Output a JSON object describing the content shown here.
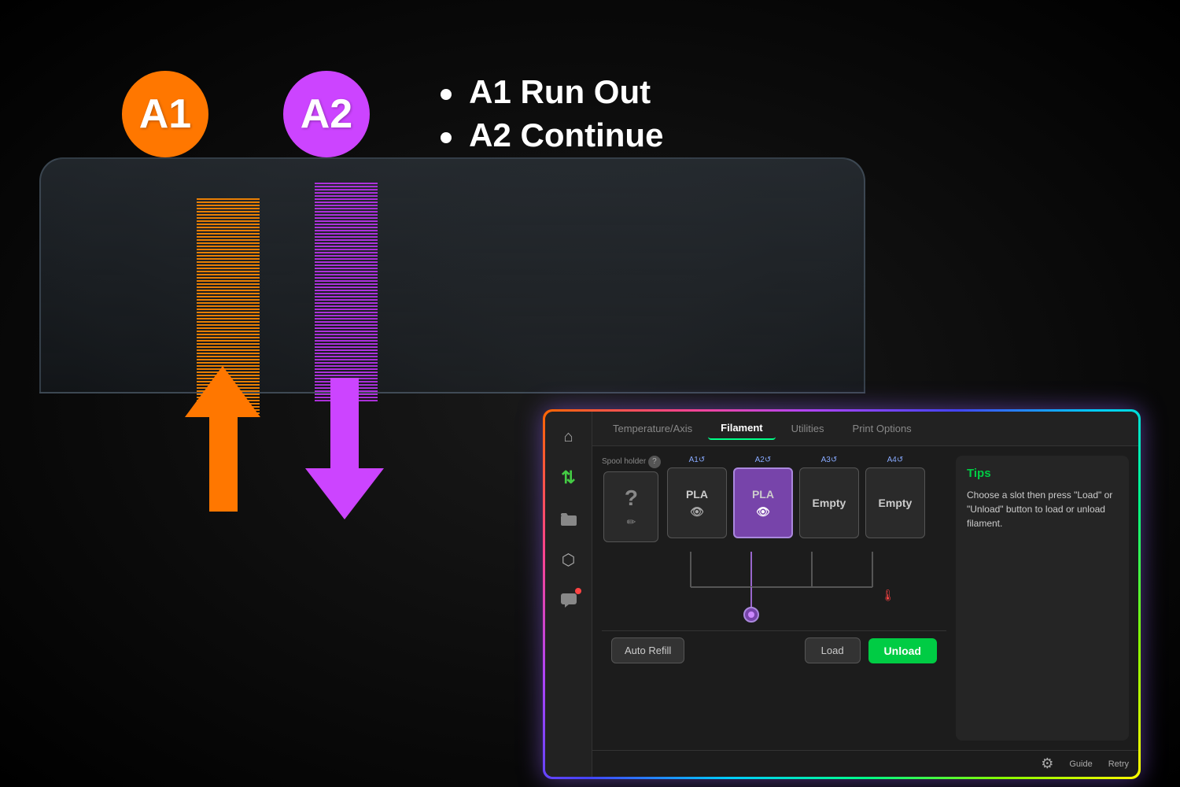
{
  "background": {
    "color": "#000000"
  },
  "badges": {
    "a1": {
      "label": "A1",
      "color": "#ff7700"
    },
    "a2": {
      "label": "A2",
      "color": "#cc44ff"
    }
  },
  "status": {
    "item1": "A1 Run Out",
    "item2": "A2 Continue"
  },
  "panel": {
    "tabs": [
      {
        "id": "temperature",
        "label": "Temperature/Axis",
        "active": false
      },
      {
        "id": "filament",
        "label": "Filament",
        "active": true
      },
      {
        "id": "utilities",
        "label": "Utilities",
        "active": false
      },
      {
        "id": "print-options",
        "label": "Print Options",
        "active": false
      }
    ],
    "sidebar": {
      "icons": [
        {
          "id": "home",
          "symbol": "⌂",
          "active": false
        },
        {
          "id": "settings",
          "symbol": "⇅",
          "active": false
        },
        {
          "id": "files",
          "symbol": "▭",
          "active": false
        },
        {
          "id": "config",
          "symbol": "⬡",
          "active": false
        },
        {
          "id": "messages",
          "symbol": "✉",
          "active": false,
          "has_dot": true
        }
      ]
    },
    "filament": {
      "spool_holder": {
        "label": "Spool holder",
        "value": "?"
      },
      "slots": [
        {
          "id": "A1",
          "label": "A1↺",
          "material": "PLA",
          "selected": false,
          "empty": false
        },
        {
          "id": "A2",
          "label": "A2↺",
          "material": "PLA",
          "selected": true,
          "empty": false
        },
        {
          "id": "A3",
          "label": "A3↺",
          "material": "Empty",
          "selected": false,
          "empty": true
        },
        {
          "id": "A4",
          "label": "A4↺",
          "material": "Empty",
          "selected": false,
          "empty": true
        }
      ],
      "buttons": {
        "auto_refill": "Auto Refill",
        "load": "Load",
        "unload": "Unload"
      }
    },
    "tips": {
      "title": "Tips",
      "text": "Choose a slot then press \"Load\" or \"Unload\" button to load or unload filament."
    },
    "actions": [
      {
        "id": "settings-gear",
        "symbol": "⚙",
        "label": ""
      },
      {
        "id": "guide",
        "label": "Guide"
      },
      {
        "id": "retry",
        "label": "Retry"
      }
    ]
  }
}
